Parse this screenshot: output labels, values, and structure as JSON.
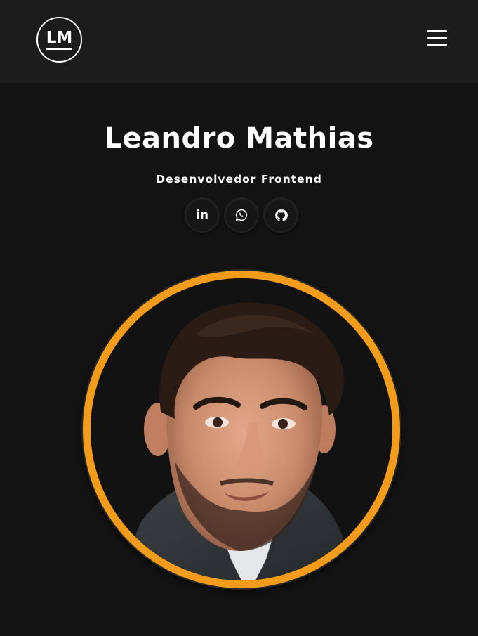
{
  "header": {
    "logo_text": "LM",
    "menu_icon": "hamburger-menu-icon"
  },
  "hero": {
    "name": "Leandro Mathias",
    "role": "Desenvolvedor Frontend",
    "social": [
      {
        "label": "in",
        "icon": "linkedin-icon"
      },
      {
        "label": "",
        "icon": "whatsapp-icon"
      },
      {
        "label": "",
        "icon": "github-icon"
      }
    ],
    "photo": "profile-photo",
    "accent_color": "#f39c1b"
  },
  "colors": {
    "background": "#131313",
    "header_background": "#1c1c1c",
    "text": "#ffffff",
    "accent": "#f39c1b"
  }
}
